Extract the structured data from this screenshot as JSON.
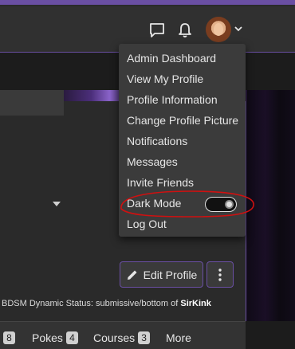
{
  "header": {
    "icons": [
      "message-icon",
      "bell-icon",
      "chevron-down-icon"
    ],
    "accent": "#6a4fa3"
  },
  "menu": {
    "items": [
      {
        "label": "Admin Dashboard"
      },
      {
        "label": "View My Profile"
      },
      {
        "label": "Profile Information"
      },
      {
        "label": "Change Profile Picture"
      },
      {
        "label": "Notifications"
      },
      {
        "label": "Messages"
      },
      {
        "label": "Invite Friends"
      },
      {
        "label": "Dark Mode"
      },
      {
        "label": "Log Out"
      }
    ],
    "dark_mode_on": true
  },
  "profile": {
    "edit_label": "Edit Profile",
    "status_prefix": "BDSM Dynamic Status: submissive/bottom of",
    "status_link": "SirKink"
  },
  "tabs": [
    {
      "label": "",
      "count": "8"
    },
    {
      "label": "Pokes",
      "count": "4"
    },
    {
      "label": "Courses",
      "count": "3"
    },
    {
      "label": "More",
      "count": ""
    }
  ],
  "annotation_color": "#d01010"
}
